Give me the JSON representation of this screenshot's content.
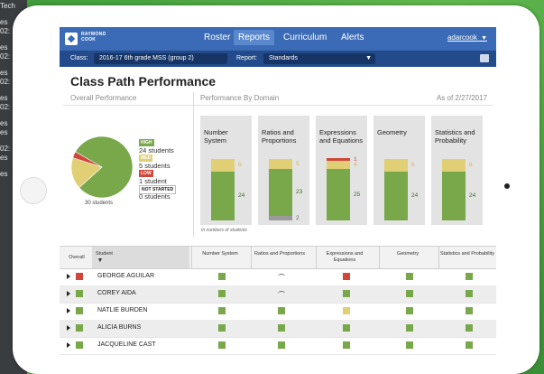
{
  "colors": {
    "high": "#78a84a",
    "med": "#e0cf75",
    "low": "#d0463a",
    "not_started": "#9a9a9a",
    "nav": "#3b6bb6",
    "subnav": "#234a8a"
  },
  "background_window": {
    "lines": [
      "Tech",
      "es",
      "02:",
      "es",
      "02:",
      "es",
      "02:",
      "es",
      "02:",
      "es",
      "es",
      "02:",
      "es",
      "es"
    ]
  },
  "nav": {
    "brand": "RAYMOND COOK",
    "tabs": [
      "Roster",
      "Reports",
      "Curriculum",
      "Alerts"
    ],
    "active_tab": "Reports",
    "user": "adarcook"
  },
  "subbar": {
    "class_label": "Class:",
    "class_value": "2016-17 6th grade MSS (group 2)",
    "report_label": "Report:",
    "report_value": "Standards"
  },
  "page": {
    "title": "Class Path Performance",
    "overall_heading": "Overall Performance",
    "domain_heading": "Performance By Domain",
    "as_of": "As of 2/27/2017",
    "chart_note": "In numbers of students"
  },
  "overall": {
    "total_label": "30 students",
    "levels": [
      {
        "badge": "HIGH",
        "text": "24 students",
        "count": 24
      },
      {
        "badge": "MED",
        "text": "5 students",
        "count": 5
      },
      {
        "badge": "LOW",
        "text": "1 student",
        "count": 1
      },
      {
        "badge": "NOT STARTED",
        "text": "0 students",
        "count": 0
      }
    ]
  },
  "chart_data": {
    "type": "bar",
    "categories": [
      "Number System",
      "Ratios and Proportions",
      "Expressions and Equations",
      "Geometry",
      "Statistics and Probability"
    ],
    "series": [
      {
        "name": "HIGH",
        "values": [
          24,
          23,
          25,
          24,
          24
        ]
      },
      {
        "name": "MED",
        "values": [
          6,
          5,
          4,
          6,
          6
        ]
      },
      {
        "name": "LOW",
        "values": [
          0,
          0,
          1,
          0,
          0
        ]
      },
      {
        "name": "NOT STARTED",
        "values": [
          0,
          2,
          0,
          0,
          0
        ]
      }
    ],
    "stacked": true
  },
  "table": {
    "headers": [
      "Overall",
      "Student",
      "Number System",
      "Ratios and Proportions",
      "Expressions and Equations",
      "Geometry",
      "Statistics and Probability"
    ],
    "rows": [
      {
        "name": "GEORGE AGUILAR",
        "overall": "low",
        "cells": [
          "high",
          "spinner",
          "low",
          "high",
          "high"
        ]
      },
      {
        "name": "COREY AIDA",
        "overall": "high",
        "cells": [
          "high",
          "spinner",
          "high",
          "high",
          "high"
        ]
      },
      {
        "name": "NATLIE BURDEN",
        "overall": "high",
        "cells": [
          "high",
          "high",
          "med",
          "high",
          "high"
        ]
      },
      {
        "name": "ALICIA BURNS",
        "overall": "high",
        "cells": [
          "high",
          "high",
          "high",
          "high",
          "high"
        ]
      },
      {
        "name": "JACQUELINE CAST",
        "overall": "high",
        "cells": [
          "high",
          "high",
          "high",
          "high",
          "high"
        ]
      }
    ]
  }
}
